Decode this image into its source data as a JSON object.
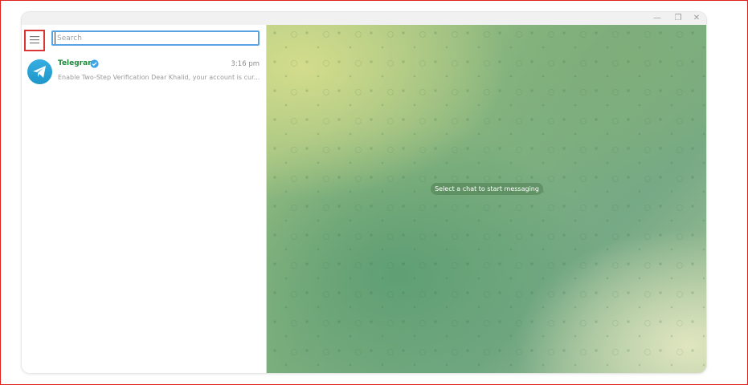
{
  "window": {
    "controls": {
      "minimize_glyph": "—",
      "maximize_glyph": "❐",
      "close_glyph": "✕"
    }
  },
  "sidebar": {
    "menu_icon": "hamburger-menu-icon",
    "search": {
      "placeholder": "Search",
      "value": ""
    },
    "chats": [
      {
        "name": "Telegram",
        "verified": true,
        "time": "3:16 pm",
        "preview": "Enable Two-Step Verification Dear Khalid, your account is cur...",
        "avatar_icon": "paper-plane-icon",
        "avatar_color": "#2aa3dc"
      }
    ]
  },
  "main": {
    "empty_state_text": "Select a chat to start messaging"
  },
  "colors": {
    "name_green": "#1d8a3a",
    "search_focus": "#58a3e4",
    "highlight_red": "#d93636",
    "verified_blue": "#3fa4e8"
  }
}
